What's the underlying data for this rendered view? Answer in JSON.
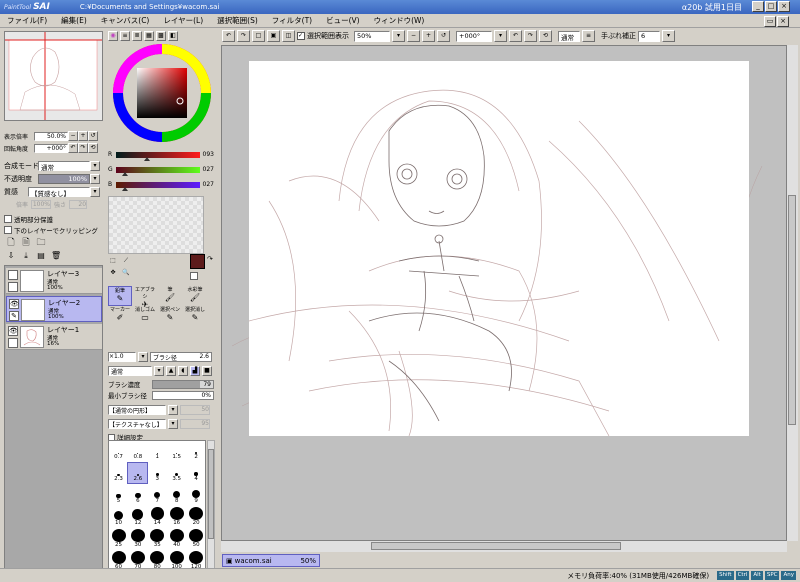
{
  "title": {
    "app_small": "PaintTool",
    "app": "SAI",
    "path": "C:¥Documents and Settings¥wacom.sai",
    "version": "α20b 試用1日目"
  },
  "menu": [
    "ファイル(F)",
    "編集(E)",
    "キャンバス(C)",
    "レイヤー(L)",
    "選択範囲(S)",
    "フィルタ(T)",
    "ビュー(V)",
    "ウィンドウ(W)"
  ],
  "navigator": {
    "zoom_label": "表示倍率",
    "zoom_value": "50.0%",
    "angle_label": "回転角度",
    "angle_value": "+000°"
  },
  "layer_props": {
    "blend_label": "合成モード",
    "blend_value": "通常",
    "opacity_label": "不透明度",
    "opacity_value": "100%",
    "texture_label": "質感",
    "texture_value": "【質感なし】",
    "scale_label": "倍率",
    "scale_value": "100%",
    "strength_label": "強さ",
    "strength_value": "20",
    "protect_label": "透明部分保護",
    "clip_label": "下のレイヤーでクリッピング"
  },
  "layers": [
    {
      "name": "レイヤー3",
      "mode": "通常",
      "opacity": "100%",
      "selected": false
    },
    {
      "name": "レイヤー2",
      "mode": "通常",
      "opacity": "100%",
      "selected": true
    },
    {
      "name": "レイヤー1",
      "mode": "通常",
      "opacity": "16%",
      "selected": false
    }
  ],
  "color": {
    "r_label": "R",
    "r_value": "093",
    "r_fraction": 0.365,
    "g_label": "G",
    "g_value": "027",
    "g_fraction": 0.106,
    "b_label": "B",
    "b_value": "027",
    "b_fraction": 0.106,
    "main": "#5d1b1b"
  },
  "tools": [
    {
      "label": "鉛筆",
      "selected": true
    },
    {
      "label": "エアブラシ",
      "selected": false
    },
    {
      "label": "筆",
      "selected": false
    },
    {
      "label": "水彩筆",
      "selected": false
    },
    {
      "label": "マーカー",
      "selected": false
    },
    {
      "label": "消しゴム",
      "selected": false
    },
    {
      "label": "選択ペン",
      "selected": false
    },
    {
      "label": "選択消し",
      "selected": false
    }
  ],
  "brush": {
    "size_mult": "×1.0",
    "size_label": "ブラシ径",
    "size_value": "2.6",
    "mode_value": "通常",
    "density_label": "ブラシ濃度",
    "density_value": "79",
    "density_fraction": 0.79,
    "min_label": "最小ブラシ径",
    "min_value": "0%",
    "shape_value": "【通常の円形】",
    "shape_strength": "50",
    "texture_value": "【テクスチャなし】",
    "texture_strength": "95",
    "detail_label": "詳細設定",
    "sizes": [
      "0.7",
      "0.8",
      "1",
      "1.5",
      "2",
      "2.3",
      "2.6",
      "3",
      "3.5",
      "4",
      "5",
      "6",
      "7",
      "8",
      "9",
      "10",
      "12",
      "14",
      "16",
      "20",
      "25",
      "30",
      "35",
      "40",
      "50",
      "60",
      "70",
      "80",
      "100",
      "120"
    ],
    "selected_size": "2.6"
  },
  "canvas_toolbar": {
    "selection_label": "選択範囲表示",
    "zoom_value": "50%",
    "angle_value": "+000°",
    "mode_value": "通常",
    "stabilizer_label": "手ぶれ補正",
    "stabilizer_value": "6"
  },
  "document": {
    "name": "wacom.sai",
    "zoom": "50%"
  },
  "status": {
    "memory": "メモリ負荷率:40% (31MB使用/426MB確保)",
    "keys": [
      "Shift",
      "Ctrl",
      "Alt",
      "SPC",
      "Any"
    ]
  }
}
